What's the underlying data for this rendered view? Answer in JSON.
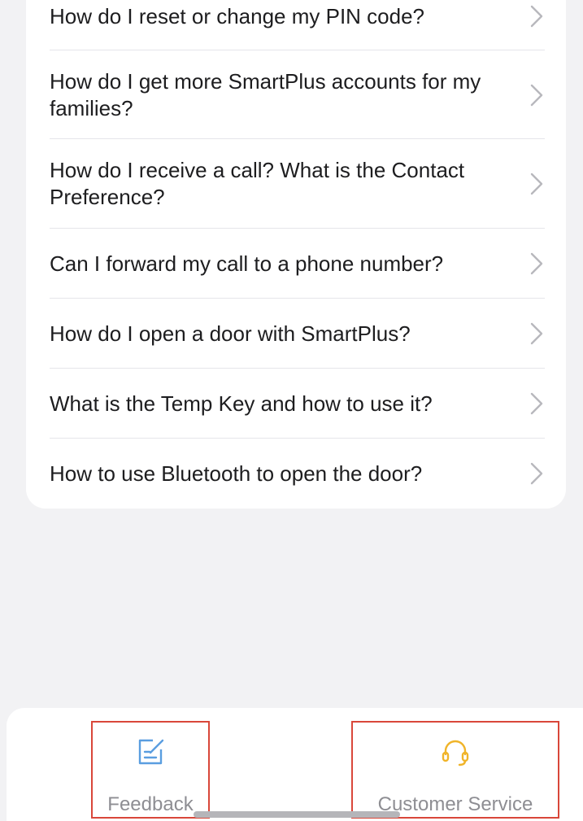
{
  "faq": {
    "items": [
      {
        "question": "How do I reset or change my PIN code?"
      },
      {
        "question": "How do I get more SmartPlus accounts for my families?"
      },
      {
        "question": "How do I receive a call? What is the Contact Preference?"
      },
      {
        "question": "Can I forward my call to a phone number?"
      },
      {
        "question": "How do I open a door with SmartPlus?"
      },
      {
        "question": "What is the Temp Key and how to use it?"
      },
      {
        "question": "How to use Bluetooth to open the door?"
      }
    ],
    "row_icon": "chevron-right-icon"
  },
  "tabbar": {
    "feedback": {
      "label": "Feedback",
      "icon": "edit-note-icon",
      "color": "#5a9ee0"
    },
    "customer_service": {
      "label": "Customer Service",
      "icon": "headset-icon",
      "color": "#f0b429"
    },
    "highlight_color": "#d9473a"
  }
}
